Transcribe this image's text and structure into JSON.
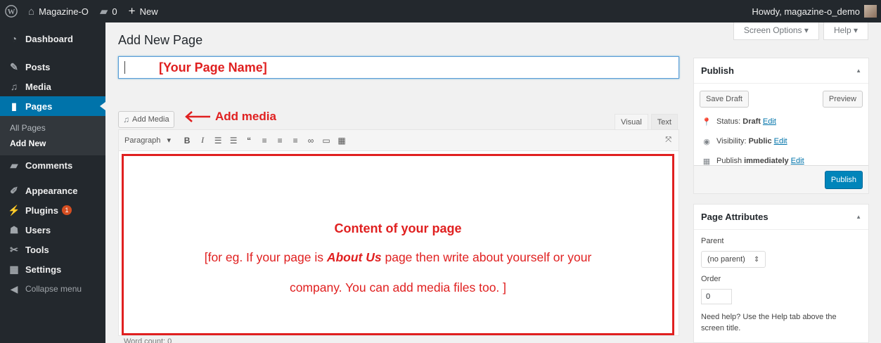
{
  "adminbar": {
    "site_name": "Magazine-O",
    "comments_count": "0",
    "new_label": "New",
    "howdy": "Howdy, magazine-o_demo"
  },
  "sidebar": {
    "items": [
      {
        "label": "Dashboard",
        "icon": "dashboard-icon"
      },
      {
        "label": "Posts",
        "icon": "pin-icon"
      },
      {
        "label": "Media",
        "icon": "media-icon"
      },
      {
        "label": "Pages",
        "icon": "pages-icon"
      },
      {
        "label": "Comments",
        "icon": "comment-icon"
      },
      {
        "label": "Appearance",
        "icon": "brush-icon"
      },
      {
        "label": "Plugins",
        "icon": "plugin-icon",
        "badge": "1"
      },
      {
        "label": "Users",
        "icon": "users-icon"
      },
      {
        "label": "Tools",
        "icon": "wrench-icon"
      },
      {
        "label": "Settings",
        "icon": "settings-icon"
      },
      {
        "label": "Collapse menu",
        "icon": "collapse-icon"
      }
    ],
    "pages_sub": [
      "All Pages",
      "Add New"
    ]
  },
  "header": {
    "title": "Add New Page",
    "screen_options": "Screen Options",
    "help": "Help"
  },
  "editor": {
    "title_value": "[Your Page Name]",
    "add_media": "Add Media",
    "add_media_note": "Add media",
    "tab_visual": "Visual",
    "tab_text": "Text",
    "format_select": "Paragraph",
    "content_heading": "Content of your page",
    "content_line1_a": "[for eg. If your page is ",
    "content_line1_em": "About Us",
    "content_line1_b": " page then write about yourself or your",
    "content_line2": "company. You can add media files too. ]",
    "word_count": "Word count: 0"
  },
  "publish": {
    "title": "Publish",
    "save_draft": "Save Draft",
    "preview": "Preview",
    "status_label": "Status:",
    "status_value": "Draft",
    "visibility_label": "Visibility:",
    "visibility_value": "Public",
    "publish_label": "Publish",
    "publish_value": "immediately",
    "edit": "Edit",
    "publish_button": "Publish"
  },
  "page_attributes": {
    "title": "Page Attributes",
    "parent_label": "Parent",
    "parent_value": "(no parent)",
    "order_label": "Order",
    "order_value": "0",
    "help_text": "Need help? Use the Help tab above the screen title."
  },
  "colors": {
    "adminbar": "#23282d",
    "accent": "#0073aa",
    "annotation": "#e02020"
  }
}
